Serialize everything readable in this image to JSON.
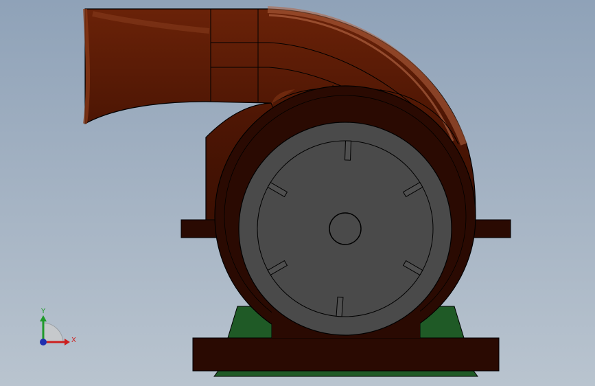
{
  "viewport": {
    "model": "centrifugal-blower",
    "view": "front"
  },
  "triad": {
    "x_label": "X",
    "y_label": "Y",
    "x_color": "#cc1f1f",
    "y_color": "#1f9a2a",
    "z_color": "#1f2fb0"
  },
  "colors": {
    "housing": "#5a1a06",
    "housing_dark": "#2a0a02",
    "housing_highlight": "#b0603c",
    "motor_face": "#4a4a4a",
    "stand": "#1f5a26",
    "outline": "#000000"
  }
}
